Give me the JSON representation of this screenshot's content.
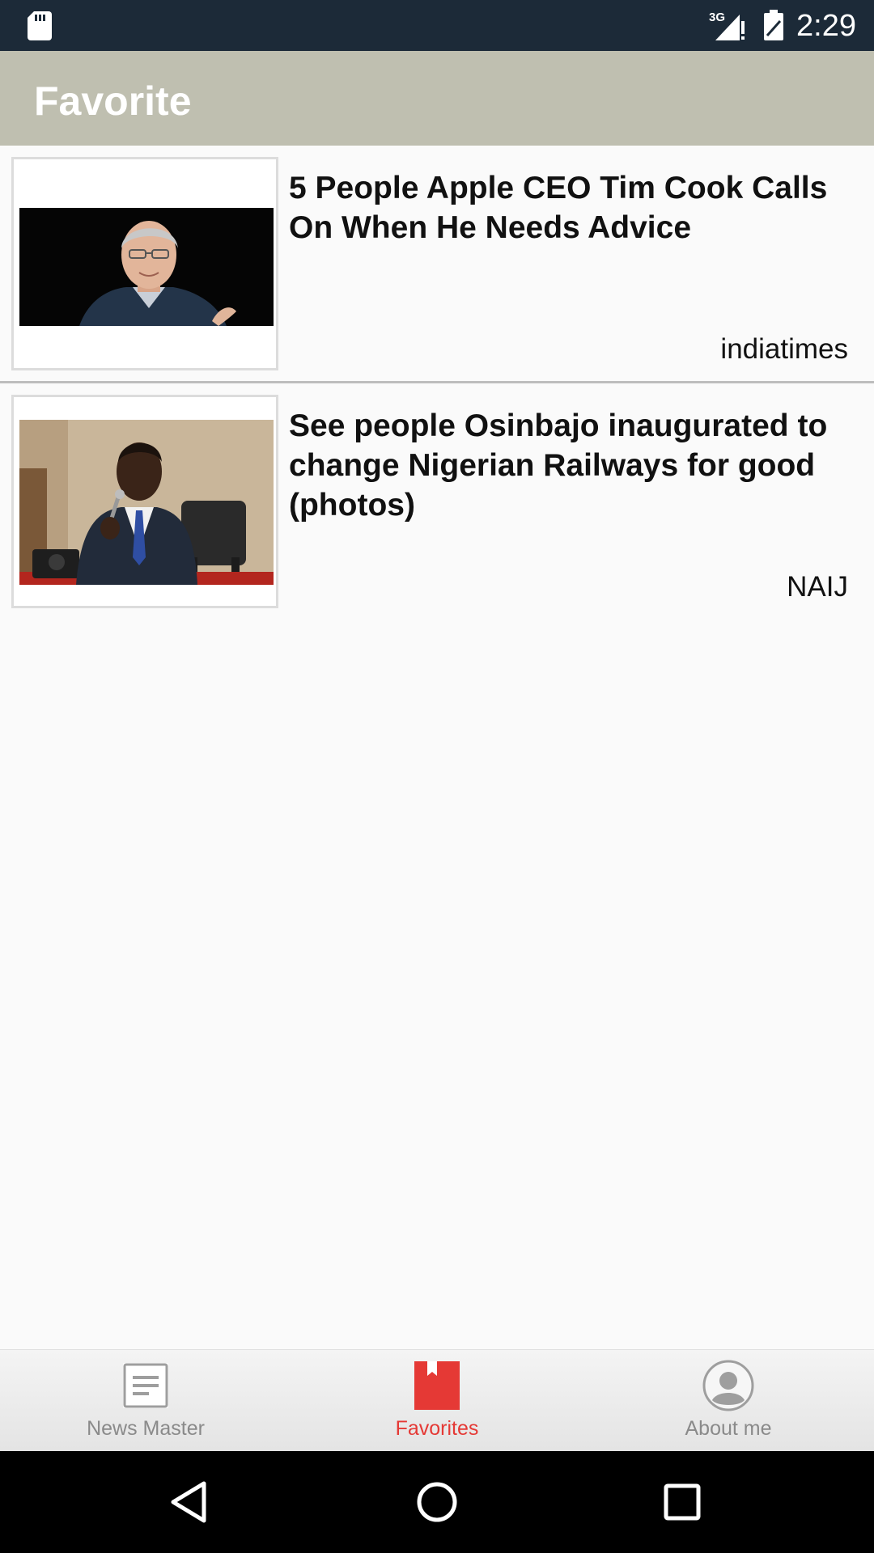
{
  "status_bar": {
    "time": "2:29",
    "network": "3G",
    "icons": [
      "sd-card-icon",
      "signal-icon",
      "battery-icon"
    ]
  },
  "app_bar": {
    "title": "Favorite"
  },
  "news": [
    {
      "title": "5 People Apple CEO Tim Cook Calls On When He Needs Advice",
      "source": "indiatimes",
      "image": "portrait-photo-dark-background"
    },
    {
      "title": "See people Osinbajo inaugurated to change Nigerian Railways for good (photos)",
      "source": "NAIJ",
      "image": "speaker-with-microphone-photo"
    }
  ],
  "bottom_nav": {
    "tabs": [
      {
        "label": "News Master",
        "icon": "news-list-icon",
        "active": false
      },
      {
        "label": "Favorites",
        "icon": "bookmark-icon",
        "active": true
      },
      {
        "label": "About me",
        "icon": "profile-icon",
        "active": false
      }
    ]
  },
  "colors": {
    "status_bar": "#1c2a38",
    "app_bar": "#bfbfb0",
    "accent": "#e53935",
    "background": "#fafafa"
  }
}
